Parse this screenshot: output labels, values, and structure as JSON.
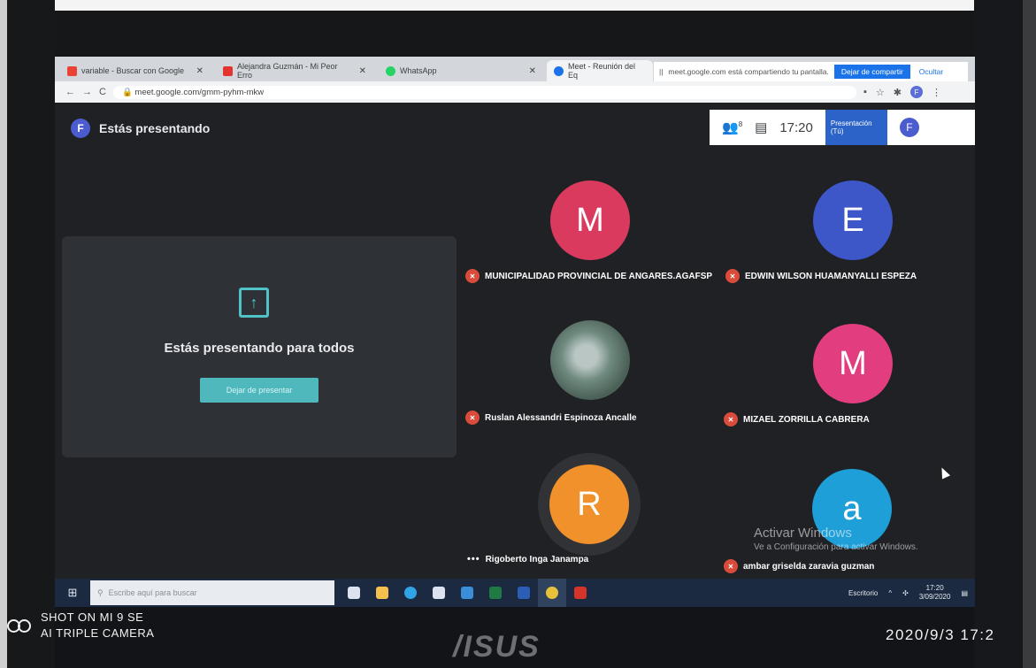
{
  "browser": {
    "tabs": [
      {
        "label": "variable - Buscar con Google",
        "favicon_color": "#ea4335"
      },
      {
        "label": "Alejandra Guzmán - Mi Peor Erro",
        "favicon_color": "#e3342f"
      },
      {
        "label": "WhatsApp",
        "favicon_color": "#25d366"
      },
      {
        "label": "Meet - Reunión del Eq",
        "favicon_color": "#1a73e8"
      }
    ],
    "share_notice": "meet.google.com está compartiendo tu pantalla.",
    "share_stop_label": "Dejar de compartir",
    "share_hide_label": "Ocultar",
    "url": "meet.google.com/gmm-pyhm-mkw"
  },
  "meet": {
    "header": {
      "avatar_letter": "F",
      "title": "Estás presentando"
    },
    "topbar": {
      "people_count": "8",
      "time": "17:20",
      "presentation_label": "Presentación",
      "presentation_sub": "(Tú)",
      "you_label": "Tú",
      "avatar_letter": "F"
    },
    "present_card": {
      "message": "Estás presentando para todos",
      "stop_label": "Dejar de presentar"
    },
    "participants": [
      {
        "letter": "M",
        "color": "#d93a5e",
        "name": "MUNICIPALIDAD PROVINCIAL DE ANGARES.AGAFSP",
        "muted": true
      },
      {
        "letter": "E",
        "color": "#3d56c8",
        "name": "EDWIN WILSON HUAMANYALLI ESPEZA",
        "muted": true
      },
      {
        "letter": "",
        "color": "#6f8a7f",
        "name": "Ruslan Alessandri Espinoza Ancalle",
        "muted": true
      },
      {
        "letter": "M",
        "color": "#e23d7f",
        "name": "MIZAEL ZORRILLA CABRERA",
        "muted": true
      },
      {
        "letter": "R",
        "color": "#f0912b",
        "name": "Rigoberto Inga Janampa",
        "muted": false
      },
      {
        "letter": "a",
        "color": "#1e9fd8",
        "name": "ambar griselda zaravia guzman",
        "muted": true
      }
    ],
    "activate_windows_title": "Activar Windows",
    "activate_windows_sub": "Ve a Configuración para activar Windows."
  },
  "taskbar": {
    "search_placeholder": "Escribe aquí para buscar",
    "desktop_label": "Escritorio",
    "time": "17:20",
    "date": "3/09/2020",
    "apps": [
      {
        "name": "task-view-icon",
        "color": "#dbe3ef"
      },
      {
        "name": "explorer-icon",
        "color": "#f2c14e"
      },
      {
        "name": "edge-icon",
        "color": "#2fa4e7"
      },
      {
        "name": "store-icon",
        "color": "#dbe3ef"
      },
      {
        "name": "mail-icon",
        "color": "#3b8fd9"
      },
      {
        "name": "excel-icon",
        "color": "#1f7a44"
      },
      {
        "name": "word-icon",
        "color": "#2b5eb7"
      },
      {
        "name": "chrome-icon",
        "color": "#e8c13a"
      },
      {
        "name": "acrobat-icon",
        "color": "#d4342a"
      }
    ]
  },
  "overlay": {
    "shot_line1": "SHOT ON MI 9 SE",
    "shot_line2": "AI TRIPLE CAMERA",
    "brand": "/ISUS",
    "stamp": "2020/9/3  17:2"
  }
}
